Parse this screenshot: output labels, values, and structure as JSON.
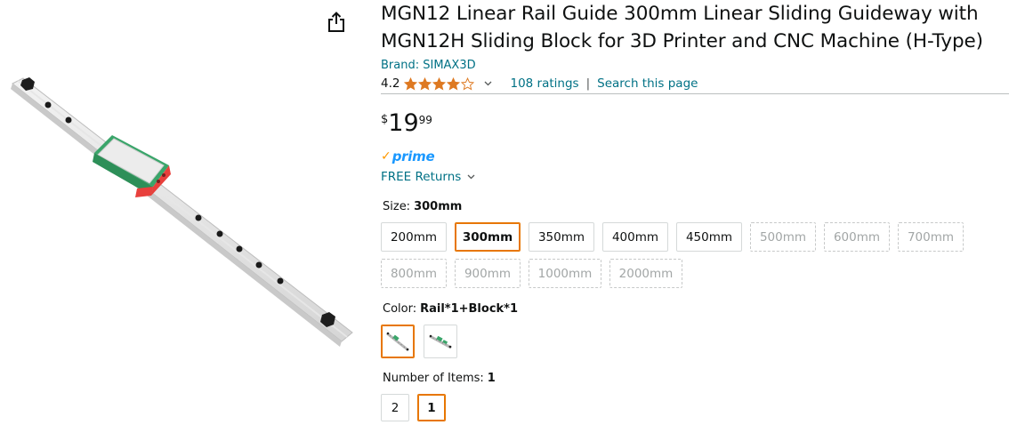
{
  "product": {
    "title_line1": "MGN12 Linear Rail Guide 300mm Linear Sliding Guideway with",
    "title_line2": "MGN12H Sliding Block for 3D Printer and CNC Machine (H-Type)",
    "brand": "Brand: SIMAX3D",
    "rating": "4.2",
    "stars_filled": 4,
    "ratings_count": "108 ratings",
    "separator": "|",
    "search_link": "Search this page"
  },
  "price": {
    "symbol": "$",
    "whole": "19",
    "fraction": "99"
  },
  "prime": {
    "check": "✓",
    "word": "prime"
  },
  "returns": {
    "label": "FREE Returns"
  },
  "size": {
    "label": "Size:",
    "selected": "300mm",
    "options": [
      {
        "label": "200mm",
        "state": "available"
      },
      {
        "label": "300mm",
        "state": "selected"
      },
      {
        "label": "350mm",
        "state": "available"
      },
      {
        "label": "400mm",
        "state": "available"
      },
      {
        "label": "450mm",
        "state": "available"
      },
      {
        "label": "500mm",
        "state": "unavailable"
      },
      {
        "label": "600mm",
        "state": "unavailable"
      },
      {
        "label": "700mm",
        "state": "unavailable"
      },
      {
        "label": "800mm",
        "state": "unavailable"
      },
      {
        "label": "900mm",
        "state": "unavailable"
      },
      {
        "label": "1000mm",
        "state": "unavailable"
      },
      {
        "label": "2000mm",
        "state": "unavailable"
      }
    ]
  },
  "color": {
    "label": "Color:",
    "selected": "Rail*1+Block*1"
  },
  "items": {
    "label": "Number of Items:",
    "selected": "1",
    "options": [
      {
        "label": "2",
        "state": "available"
      },
      {
        "label": "1",
        "state": "selected"
      }
    ]
  },
  "colors": {
    "link": "#007185",
    "selection": "#e77600",
    "prime_blue": "#1a98ff",
    "prime_check": "#ff9900",
    "star": "#de7921",
    "rail_green": "#3aa56a",
    "block_red": "#e8403c"
  },
  "icons": [
    "share-icon",
    "star-icon",
    "chevron-down-icon",
    "prime-check-icon"
  ]
}
